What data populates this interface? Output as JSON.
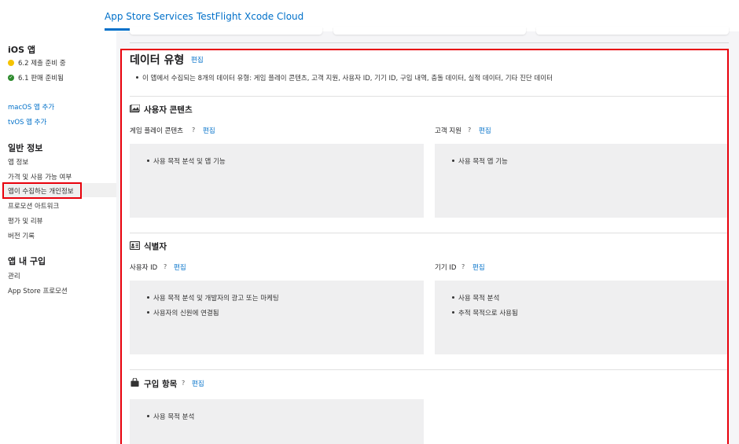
{
  "topnav": {
    "tabs": [
      "App Store",
      "Services",
      "TestFlight",
      "Xcode Cloud"
    ]
  },
  "sidebar": {
    "ios_title": "iOS 앱",
    "status_62": "6.2 제출 준비 중",
    "status_61": "6.1 판매 준비됨",
    "add_macos": "macOS 앱 추가",
    "add_tvos": "tvOS 앱 추가",
    "general_title": "일반 정보",
    "general_items": [
      "앱 정보",
      "가격 및 사용 가능 여부",
      "앱이 수집하는 개인정보",
      "프로모션 아트워크",
      "평가 및 리뷰",
      "버전 기록"
    ],
    "iap_title": "앱 내 구입",
    "iap_items": [
      "관리",
      "App Store 프로모션"
    ]
  },
  "main": {
    "heading": "데이터 유형",
    "edit_label": "편집",
    "summary": "이 앱에서 수집되는 8개의 데이터 유형: 게임 플레이 콘텐츠, 고객 지원, 사용자 ID, 기기 ID, 구입 내역, 충돌 데이터, 실적 데이터, 기타 진단 데이터",
    "help_mark": "?",
    "sections": {
      "user_content": {
        "title": "사용자 콘텐츠",
        "items": [
          {
            "label": "게임 플레이 콘텐츠",
            "purposes": [
              "사용 목적 분석 및 앱 기능"
            ]
          },
          {
            "label": "고객 지원",
            "purposes": [
              "사용 목적 앱 기능"
            ]
          }
        ]
      },
      "identifiers": {
        "title": "식별자",
        "items": [
          {
            "label": "사용자 ID",
            "purposes": [
              "사용 목적 분석 및 개발자의 광고 또는 마케팅",
              "사용자의 신원에 연결됨"
            ]
          },
          {
            "label": "기기 ID",
            "purposes": [
              "사용 목적 분석",
              "추적 목적으로 사용됨"
            ]
          }
        ]
      },
      "purchases": {
        "title": "구입 항목",
        "purposes": [
          "사용 목적 분석"
        ]
      }
    }
  }
}
